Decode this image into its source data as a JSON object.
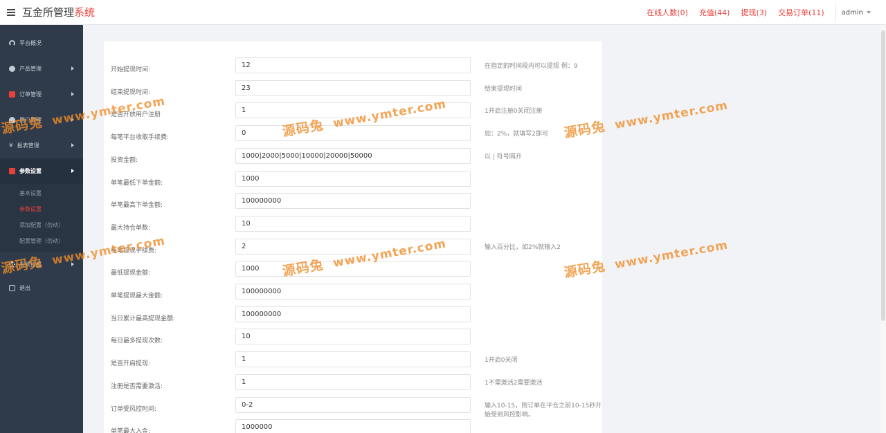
{
  "app": {
    "title_main": "互金所管理",
    "title_accent": "系统"
  },
  "topnav": {
    "links": [
      "在线人数(0)",
      "充值(44)",
      "提现(3)",
      "交易订单(11)"
    ],
    "user": "admin"
  },
  "sidebar": {
    "items": [
      {
        "label": "平台概况",
        "icon": "dashboard-icon"
      },
      {
        "label": "产品管理",
        "icon": "bitcoin-icon"
      },
      {
        "label": "订单管理",
        "icon": "order-icon"
      },
      {
        "label": "用户管理",
        "icon": "user-icon"
      },
      {
        "label": "报表管理",
        "icon": "yen-icon"
      },
      {
        "label": "参数设置",
        "icon": "settings-doc-icon"
      },
      {
        "label": "系统设置",
        "icon": "gears-icon"
      },
      {
        "label": "退出",
        "icon": "signout-icon"
      }
    ],
    "submenu": [
      "基本设置",
      "参数设置",
      "添加配置（勿动）",
      "配置管理（勿动）"
    ]
  },
  "form": {
    "rows": [
      {
        "label": "开始提现时间:",
        "value": "12",
        "hint": "在指定的时间段内可以提现 例：9"
      },
      {
        "label": "结束提现时间:",
        "value": "23",
        "hint": "结束提现时间"
      },
      {
        "label": "是否开放用户注册",
        "value": "1",
        "hint": "1开启注册0关闭注册"
      },
      {
        "label": "每笔平台收取手续费:",
        "value": "0",
        "hint": "如：2%，就填写2即可"
      },
      {
        "label": "投资金额:",
        "value": "1000|2000|5000|10000|20000|50000",
        "hint": "以 | 符号隔开"
      },
      {
        "label": "单笔最低下单金额:",
        "value": "1000",
        "hint": ""
      },
      {
        "label": "单笔最高下单金额:",
        "value": "100000000",
        "hint": ""
      },
      {
        "label": "最大持仓单数:",
        "value": "10",
        "hint": ""
      },
      {
        "label": "每笔提现手续费:",
        "value": "2",
        "hint": "输入百分比，如2%就输入2"
      },
      {
        "label": "最低提现金额:",
        "value": "1000",
        "hint": ""
      },
      {
        "label": "单笔提现最大金额:",
        "value": "100000000",
        "hint": ""
      },
      {
        "label": "当日累计最高提现金额:",
        "value": "100000000",
        "hint": ""
      },
      {
        "label": "每日最多提现次数:",
        "value": "10",
        "hint": ""
      },
      {
        "label": "是否开启提现:",
        "value": "1",
        "hint": "1开启0关闭"
      },
      {
        "label": "注册是否需要激活:",
        "value": "1",
        "hint": "1不需激活2需要激活"
      },
      {
        "label": "订单受风控时间:",
        "value": "0-2",
        "hint": "输入10-15，则订单在平仓之前10-15秒开始受到风控影响。"
      },
      {
        "label": "单笔最大入金:",
        "value": "1000000",
        "hint": ""
      }
    ]
  },
  "watermark": {
    "brand": "源码兔",
    "url": "www.ymter.com"
  },
  "colors": {
    "accent": "#e8413a",
    "sidebar_bg": "#2f3b4a",
    "watermark": "#f08c28"
  }
}
